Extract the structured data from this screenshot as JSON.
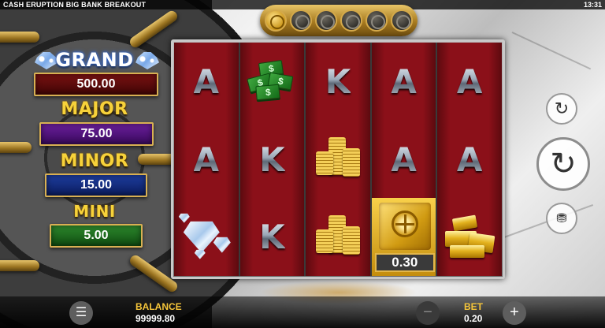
{
  "header": {
    "game_title": "CASH ERUPTION BIG BANK BREAKOUT",
    "clock": "13:31"
  },
  "progress": {
    "medallions": [
      {
        "state": "active"
      },
      {
        "state": "inactive"
      },
      {
        "state": "inactive"
      },
      {
        "state": "inactive"
      },
      {
        "state": "inactive"
      },
      {
        "state": "inactive"
      }
    ]
  },
  "jackpots": {
    "grand": {
      "label": "GRAND",
      "value": "500.00"
    },
    "major": {
      "label": "MAJOR",
      "value": "75.00"
    },
    "minor": {
      "label": "MINOR",
      "value": "15.00"
    },
    "mini": {
      "label": "MINI",
      "value": "5.00"
    }
  },
  "reels": [
    [
      "A",
      "A",
      "diamonds"
    ],
    [
      "money",
      "K",
      "K"
    ],
    [
      "K",
      "coins",
      "coins"
    ],
    [
      "A",
      "A",
      "cash-safe"
    ],
    [
      "A",
      "A",
      "gold-bars"
    ]
  ],
  "cash_symbol": {
    "value": "0.30"
  },
  "controls": {
    "menu_icon": "menu-icon",
    "autoplay_icon": "autoplay-icon",
    "spin_icon": "spin-icon",
    "bet_options_icon": "coins-icon"
  },
  "footer": {
    "balance_label": "BALANCE",
    "balance_value": "99999.80",
    "bet_label": "BET",
    "bet_value": "0.20",
    "minus_symbol": "−",
    "plus_symbol": "+"
  },
  "colors": {
    "reel_red": "#8b1019",
    "gold_accent": "#f5c53a",
    "grand_box": "#7a1212",
    "major_box": "#6c1f9e",
    "minor_box": "#1e3ea0",
    "mini_box": "#2d8a2d"
  }
}
